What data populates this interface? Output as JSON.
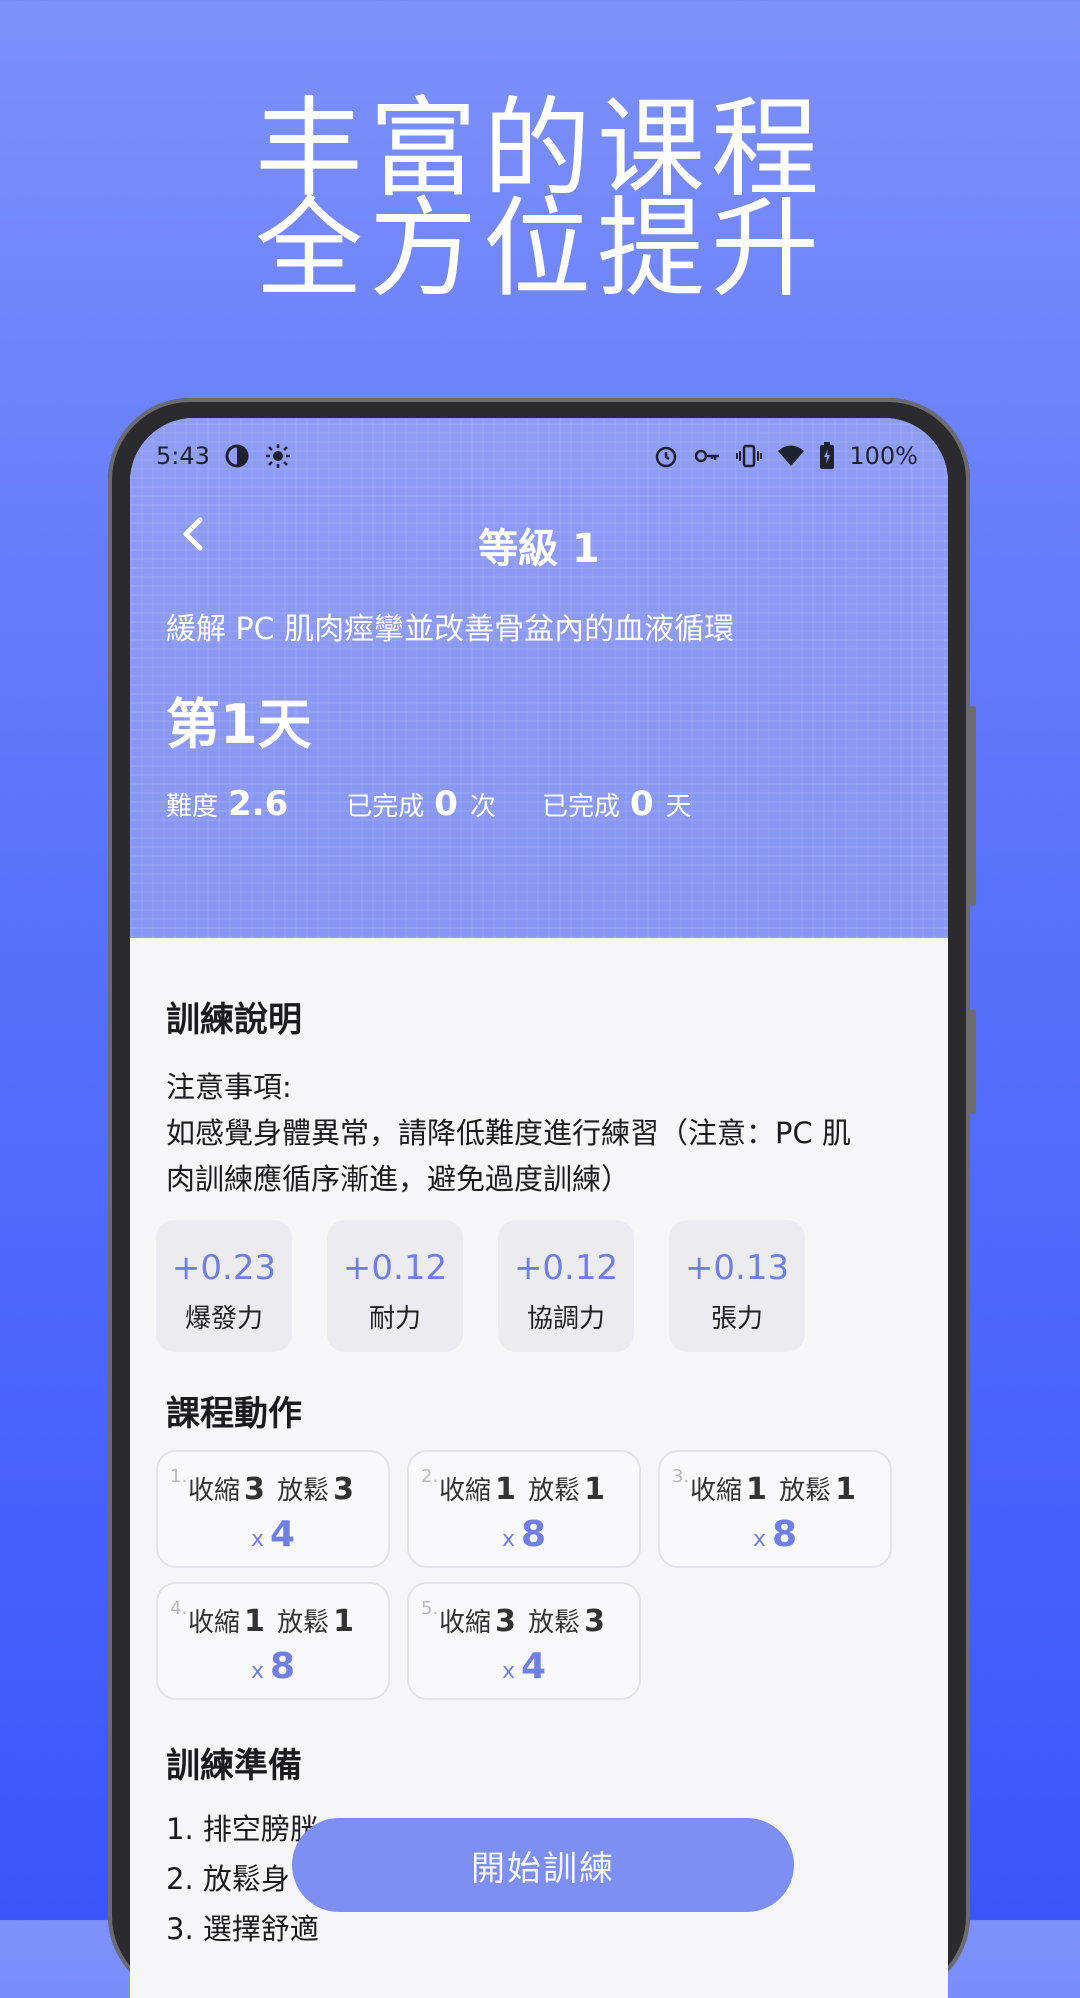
{
  "promo": {
    "line1": "丰富的课程",
    "line2": "全方位提升"
  },
  "status_bar": {
    "time": "5:43",
    "battery": "100%",
    "icons": [
      "data-saver-icon",
      "brightness-icon",
      "alarm-icon",
      "vpn-key-icon",
      "vibrate-icon",
      "wifi-icon",
      "battery-icon"
    ]
  },
  "header": {
    "title": "等級  1",
    "back_icon": "chevron-left-icon"
  },
  "hero": {
    "subtitle": "緩解 PC 肌肉痙攣並改善骨盆內的血液循環",
    "day": "第1天",
    "stats": [
      {
        "label": "難度",
        "value": "2.6",
        "unit": ""
      },
      {
        "label": "已完成",
        "value": "0",
        "unit": "次"
      },
      {
        "label": "已完成",
        "value": "0",
        "unit": "天"
      }
    ]
  },
  "training_info": {
    "title": "訓練說明",
    "notes_heading": "注意事項:",
    "notes_line1": "如感覺身體異常，請降低難度進行練習（注意：PC 肌",
    "notes_line2": "肉訓練應循序漸進，避免過度訓練）"
  },
  "attributes": [
    {
      "value": "+0.23",
      "label": "爆發力"
    },
    {
      "value": "+0.12",
      "label": "耐力"
    },
    {
      "value": "+0.12",
      "label": "協調力"
    },
    {
      "value": "+0.13",
      "label": "張力"
    }
  ],
  "moves": {
    "title": "課程動作",
    "contract_label": "收縮",
    "relax_label": "放鬆",
    "rep_prefix": "x",
    "items": [
      {
        "num": "1.",
        "contract": "3",
        "relax": "3",
        "reps": "4"
      },
      {
        "num": "2.",
        "contract": "1",
        "relax": "1",
        "reps": "8"
      },
      {
        "num": "3.",
        "contract": "1",
        "relax": "1",
        "reps": "8"
      },
      {
        "num": "4.",
        "contract": "1",
        "relax": "1",
        "reps": "8"
      },
      {
        "num": "5.",
        "contract": "3",
        "relax": "3",
        "reps": "4"
      }
    ]
  },
  "prep": {
    "title": "訓練準備",
    "items": [
      "1. 排空膀胱",
      "2. 放鬆身",
      "3. 選擇舒適"
    ]
  },
  "start_button": "開始訓練",
  "colors": {
    "accent": "#6f7fe6",
    "hero": "#8b98f4",
    "button": "#7e8ff4",
    "background_top": "#7d90fb",
    "background_bottom": "#3a56fb"
  }
}
